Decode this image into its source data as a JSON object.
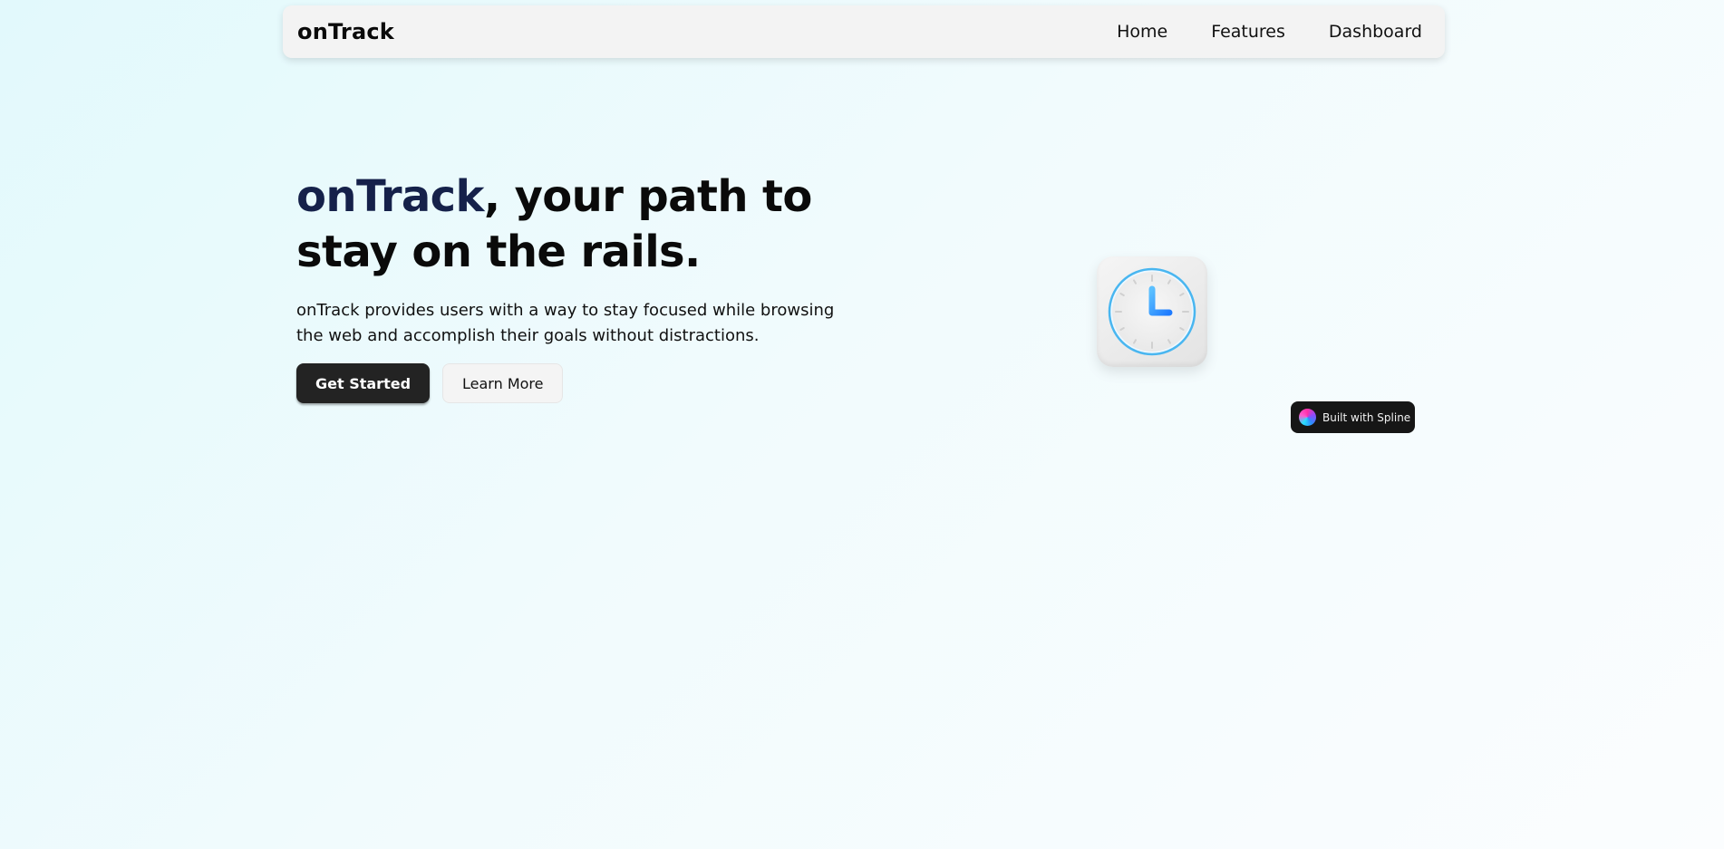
{
  "nav": {
    "brand": "onTrack",
    "links": [
      "Home",
      "Features",
      "Dashboard"
    ]
  },
  "hero": {
    "title_accent": "onTrack",
    "title_rest": ", your path to stay on the rails.",
    "description": "onTrack provides users with a way to stay focused while browsing the web and accomplish their goals without distractions.",
    "primary_button": "Get Started",
    "secondary_button": "Learn More"
  },
  "illustration": {
    "icon": "clock-icon"
  },
  "badge": {
    "icon": "spline-logo-icon",
    "label": "Built with Spline"
  },
  "colors": {
    "brand_accent": "#15214a",
    "primary_button": "#232323",
    "clock_accent": "#2e9bff"
  }
}
